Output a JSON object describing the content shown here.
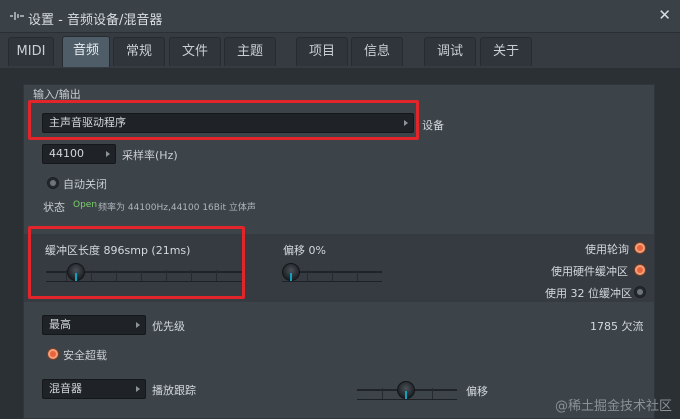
{
  "window": {
    "title": "设置 - 音频设备/混音器"
  },
  "tabs": [
    {
      "label": "MIDI"
    },
    {
      "label": "音频"
    },
    {
      "label": "常规"
    },
    {
      "label": "文件"
    },
    {
      "label": "主题"
    },
    {
      "label": "项目"
    },
    {
      "label": "信息"
    },
    {
      "label": "调试"
    },
    {
      "label": "关于"
    }
  ],
  "io": {
    "header": "输入/输出",
    "device_value": "主声音驱动程序",
    "device_label": "设备",
    "samplerate_value": "44100",
    "samplerate_label": "采样率(Hz)",
    "autoclose_label": "自动关闭",
    "status_label": "状态",
    "status_open": "Open",
    "status_info": "频率为 44100Hz,44100 16Bit 立体声"
  },
  "buffer": {
    "label": "缓冲区长度 896smp (21ms)",
    "offset_label": "偏移 0%",
    "use_polling": "使用轮询",
    "use_hw_buffer": "使用硬件缓冲区",
    "use_32bit_buffer": "使用 32 位缓冲区",
    "level": 0.12,
    "offset_level": 0.0
  },
  "priority": {
    "value": "最高",
    "label": "优先级",
    "underruns": "1785 欠流",
    "safe_overload": "安全超载"
  },
  "mixer": {
    "value": "混音器",
    "label": "播放跟踪",
    "offset_label": "偏移"
  },
  "watermark": "@稀土掘金技术社区",
  "colors": {
    "accent": "#e9643c",
    "highlight": "#e2252b",
    "status_green": "#7bd06a"
  }
}
